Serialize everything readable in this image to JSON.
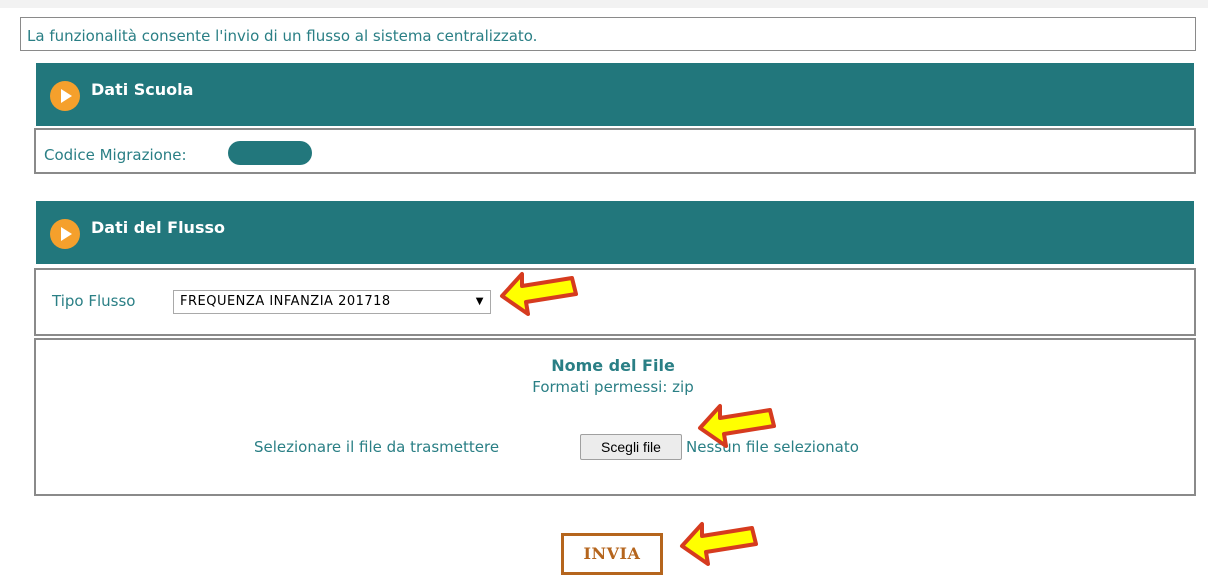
{
  "intro": {
    "text": "La funzionalità consente l'invio di un flusso al sistema centralizzato."
  },
  "sections": {
    "dati_scuola": {
      "title": "Dati Scuola",
      "codice_label": "Codice Migrazione:"
    },
    "dati_flusso": {
      "title": "Dati del Flusso",
      "tipo_label": "Tipo Flusso",
      "tipo_value": "FREQUENZA INFANZIA 201718",
      "file_title": "Nome del File",
      "file_formats": "Formati permessi: zip",
      "select_label": "Selezionare il file da trasmettere",
      "choose_button": "Scegli file",
      "no_file_text": "Nessun file selezionato"
    }
  },
  "actions": {
    "invia_label": "INVIA"
  },
  "colors": {
    "header_bg": "#22777c",
    "text": "#2a7f85",
    "accent_orange": "#f5a02c",
    "invia_border": "#b5651d",
    "arrow_fill": "#ffff00",
    "arrow_stroke": "#d63b1f"
  },
  "icons": {
    "section_icon": "play-circle-icon",
    "annotation": "yellow-arrow-icon"
  }
}
